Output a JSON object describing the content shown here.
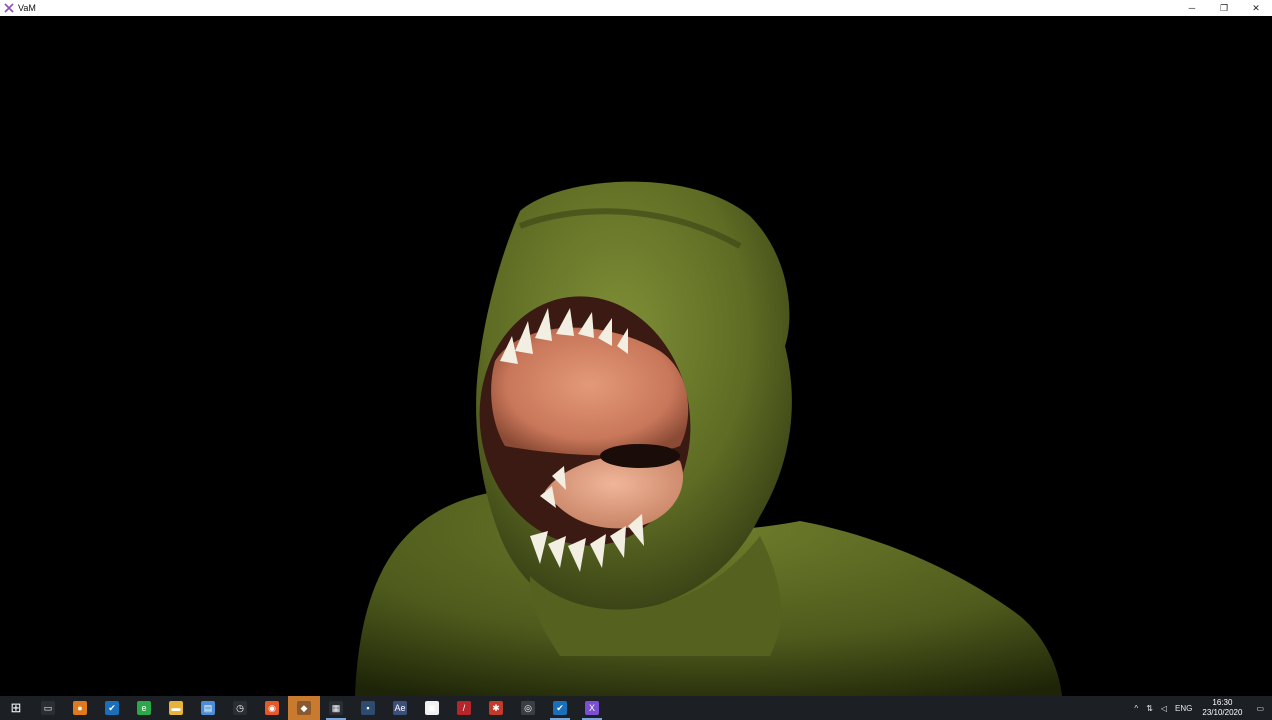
{
  "window": {
    "title": "VaM",
    "controls": {
      "minimize": "─",
      "restore": "❐",
      "close": "✕"
    }
  },
  "taskbar": {
    "start_glyph": "⊞",
    "items": [
      {
        "name": "task-view-icon",
        "glyph": "▭",
        "color": "#2a2f36",
        "state": ""
      },
      {
        "name": "app-orange-icon",
        "glyph": "●",
        "color": "#e07a1f",
        "state": ""
      },
      {
        "name": "steam-icon",
        "glyph": "✔",
        "color": "#1b6fb8",
        "state": ""
      },
      {
        "name": "edge-icon",
        "glyph": "e",
        "color": "#2aa84a",
        "state": ""
      },
      {
        "name": "file-explorer-icon",
        "glyph": "▬",
        "color": "#e6b43a",
        "state": ""
      },
      {
        "name": "notes-icon",
        "glyph": "▤",
        "color": "#4c8ed6",
        "state": ""
      },
      {
        "name": "clock-app-icon",
        "glyph": "◷",
        "color": "#2a2f36",
        "state": ""
      },
      {
        "name": "firefox-icon",
        "glyph": "◉",
        "color": "#e5582a",
        "state": ""
      },
      {
        "name": "unity-app-icon",
        "glyph": "◆",
        "color": "#8a5a2e",
        "state": "active"
      },
      {
        "name": "clapper-icon",
        "glyph": "▦",
        "color": "#2a2f36",
        "state": "open"
      },
      {
        "name": "vr-app-icon",
        "glyph": "▪",
        "color": "#2e4a6e",
        "state": ""
      },
      {
        "name": "ae-icon",
        "glyph": "Ae",
        "color": "#3a4f7a",
        "state": ""
      },
      {
        "name": "screen-capture-icon",
        "glyph": "▣",
        "color": "#f0f0f0",
        "state": ""
      },
      {
        "name": "pen-app-icon",
        "glyph": "/",
        "color": "#b3262a",
        "state": ""
      },
      {
        "name": "bug-app-icon",
        "glyph": "✱",
        "color": "#c23a2a",
        "state": ""
      },
      {
        "name": "gamepad-icon",
        "glyph": "◎",
        "color": "#3a3f46",
        "state": ""
      },
      {
        "name": "steam-vr-icon",
        "glyph": "✔",
        "color": "#1b6fb8",
        "state": "open"
      },
      {
        "name": "vam-icon",
        "glyph": "X",
        "color": "#7b4fd1",
        "state": "open"
      }
    ],
    "tray": {
      "chevron": "^",
      "network_glyph": "⇅",
      "volume_glyph": "◁",
      "language": "ENG",
      "time": "16:30",
      "date": "23/10/2020",
      "notification_glyph": "▭"
    }
  },
  "colors": {
    "taskbar_bg": "#1c1f24",
    "skin": "#6b7a2a",
    "mouth": "#d98868"
  }
}
